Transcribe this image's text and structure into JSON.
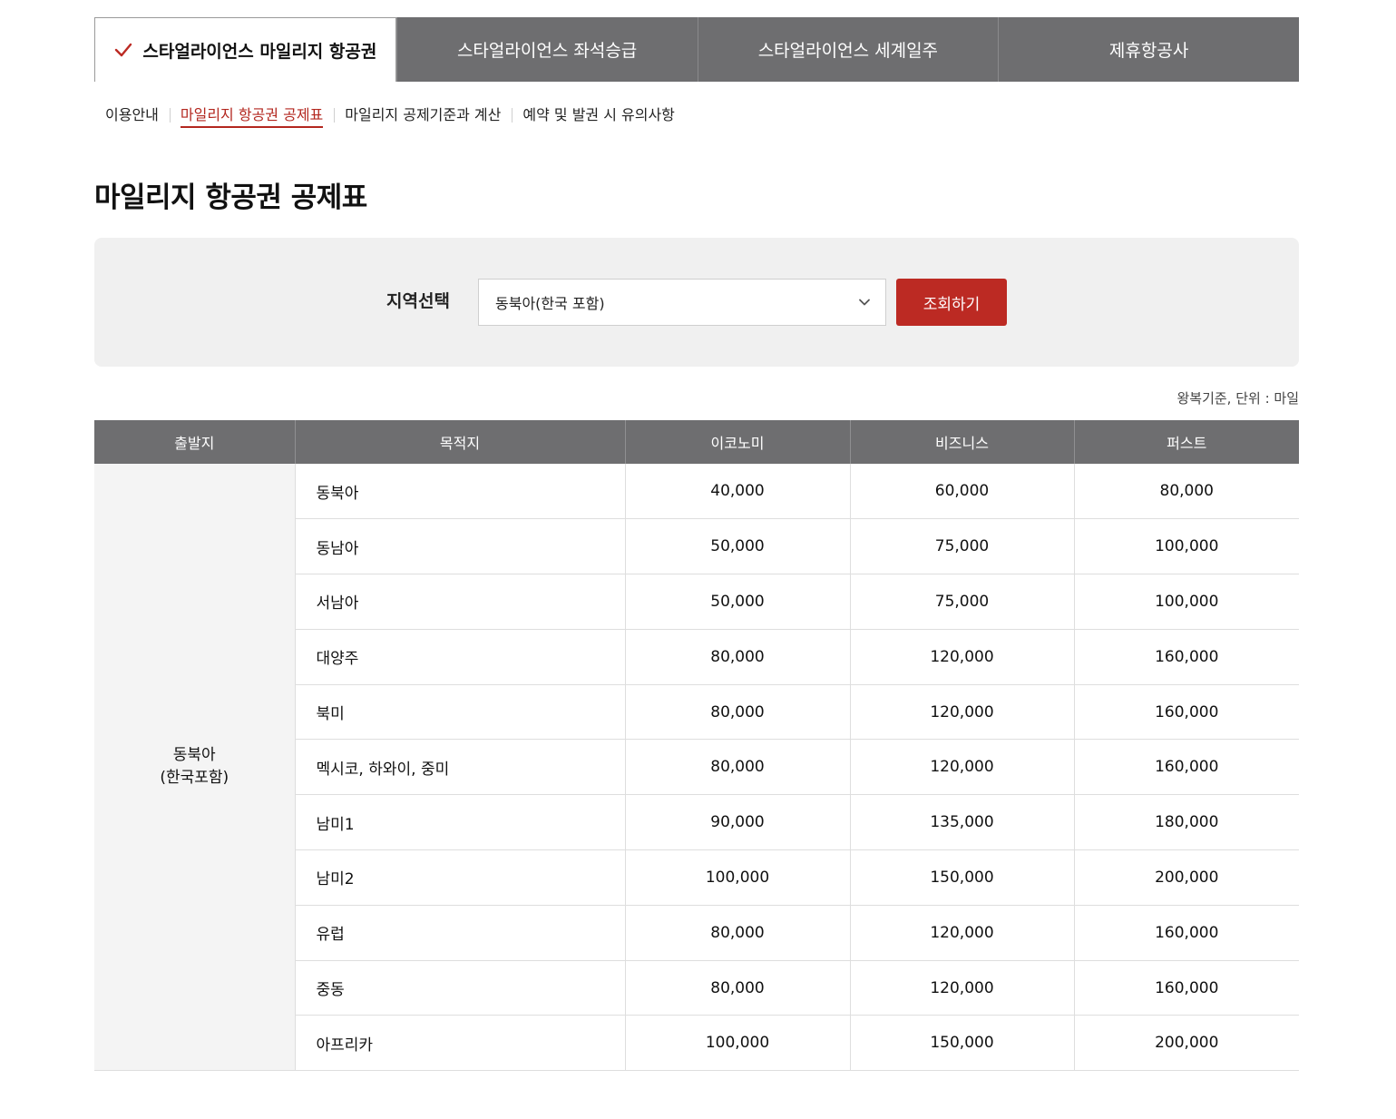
{
  "tabs": [
    {
      "label": "스타얼라이언스 마일리지 항공권",
      "active": true
    },
    {
      "label": "스타얼라이언스 좌석승급",
      "active": false
    },
    {
      "label": "스타얼라이언스 세계일주",
      "active": false
    },
    {
      "label": "제휴항공사",
      "active": false
    }
  ],
  "subnav": [
    {
      "label": "이용안내",
      "active": false
    },
    {
      "label": "마일리지 항공권 공제표",
      "active": true
    },
    {
      "label": "마일리지 공제기준과 계산",
      "active": false
    },
    {
      "label": "예약 및 발권 시 유의사항",
      "active": false
    }
  ],
  "page_title": "마일리지 항공권 공제표",
  "filter": {
    "label": "지역선택",
    "selected": "동북아(한국 포함)",
    "button": "조회하기"
  },
  "unit_note": "왕복기준, 단위 : 마일",
  "table": {
    "headers": [
      "출발지",
      "목적지",
      "이코노미",
      "비즈니스",
      "퍼스트"
    ],
    "origin_line1": "동북아",
    "origin_line2": "(한국포함)",
    "rows": [
      {
        "dest": "동북아",
        "economy": "40,000",
        "business": "60,000",
        "first": "80,000"
      },
      {
        "dest": "동남아",
        "economy": "50,000",
        "business": "75,000",
        "first": "100,000"
      },
      {
        "dest": "서남아",
        "economy": "50,000",
        "business": "75,000",
        "first": "100,000"
      },
      {
        "dest": "대양주",
        "economy": "80,000",
        "business": "120,000",
        "first": "160,000"
      },
      {
        "dest": "북미",
        "economy": "80,000",
        "business": "120,000",
        "first": "160,000"
      },
      {
        "dest": "멕시코, 하와이, 중미",
        "economy": "80,000",
        "business": "120,000",
        "first": "160,000"
      },
      {
        "dest": "남미1",
        "economy": "90,000",
        "business": "135,000",
        "first": "180,000"
      },
      {
        "dest": "남미2",
        "economy": "100,000",
        "business": "150,000",
        "first": "200,000"
      },
      {
        "dest": "유럽",
        "economy": "80,000",
        "business": "120,000",
        "first": "160,000"
      },
      {
        "dest": "중동",
        "economy": "80,000",
        "business": "120,000",
        "first": "160,000"
      },
      {
        "dest": "아프리카",
        "economy": "100,000",
        "business": "150,000",
        "first": "200,000"
      }
    ]
  },
  "colors": {
    "accent": "#bc2a23",
    "tab_bg": "#6e6e70",
    "filter_bg": "#f0f0f0"
  },
  "icons": {
    "active_tab": "check-icon",
    "select": "chevron-down-icon"
  }
}
